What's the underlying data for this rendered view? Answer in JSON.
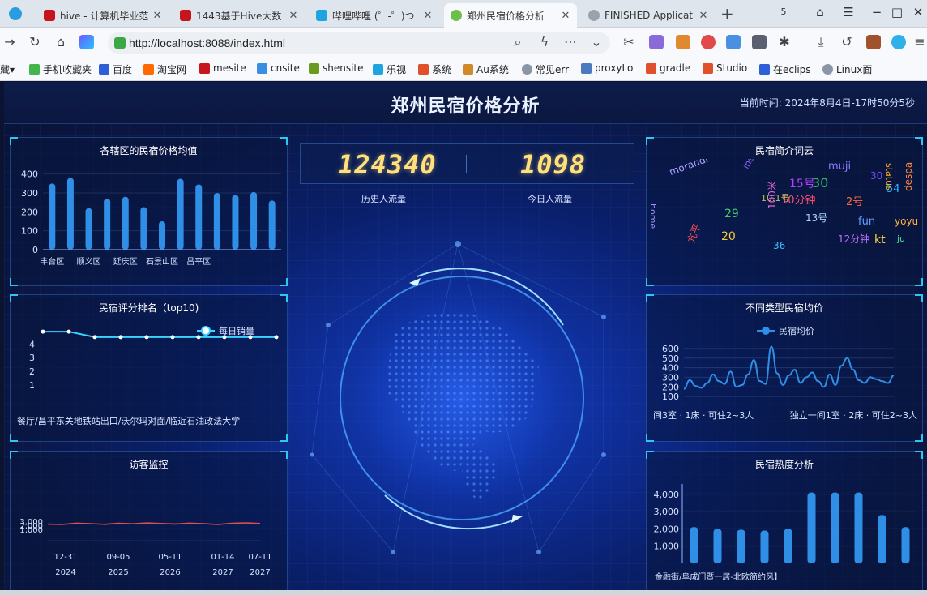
{
  "browser": {
    "tabs": [
      {
        "title": "hive - 计算机毕业范",
        "active": false
      },
      {
        "title": "1443基于Hive大数",
        "active": false
      },
      {
        "title": "哔哩哔哩 (゜-゜)つ",
        "active": false
      },
      {
        "title": "郑州民宿价格分析",
        "active": true
      },
      {
        "title": "FINISHED Applicat",
        "active": false
      }
    ],
    "url": "http://localhost:8088/index.html",
    "bookmarks": [
      "藏",
      "手机收藏夹",
      "百度",
      "淘宝网",
      "mesite",
      "cnsite",
      "shensite",
      "乐视",
      "系统",
      "Au系统",
      "常见err",
      "proxyLo",
      "gradle",
      "Studio",
      "在eclips",
      "Linux面"
    ]
  },
  "dashboard": {
    "title": "郑州民宿价格分析",
    "time_label": "当前时间:",
    "time_value": "2024年8月4日-17时50分5秒",
    "counters": [
      {
        "value": "124340",
        "label": "历史人流量"
      },
      {
        "value": "1098",
        "label": "今日人流量"
      }
    ],
    "panels": {
      "district": "各辖区的民宿价格均值",
      "rating": "民宿评分排名（top10)",
      "visitor": "访客监控",
      "wordcloud": "民宿简介词云",
      "typeavg": "不同类型民宿均价",
      "heat": "民宿热度分析"
    }
  },
  "chart_data": [
    {
      "id": "district",
      "type": "bar",
      "title": "各辖区的民宿价格均值",
      "categories": [
        "丰台区",
        "",
        "顺义区",
        "",
        "延庆区",
        "",
        "石景山区",
        "",
        "昌平区",
        "",
        "",
        "",
        ""
      ],
      "values": [
        350,
        380,
        220,
        270,
        280,
        225,
        150,
        375,
        345,
        300,
        290,
        305,
        260
      ],
      "yticks": [
        0,
        100,
        200,
        300,
        400
      ],
      "ylim": [
        0,
        420
      ]
    },
    {
      "id": "rating",
      "type": "line",
      "title": "民宿评分排名（top10)",
      "legend": "每日销量",
      "values": [
        4.9,
        4.9,
        4.5,
        4.5,
        4.5,
        4.5,
        4.5,
        4.5,
        4.5,
        4.5
      ],
      "yticks": [
        1,
        2,
        3,
        4
      ],
      "ylim": [
        0,
        5.2
      ],
      "xlabel_text": "餐厅/昌平东关地铁站出口/沃尔玛对面/临近石油政法大学"
    },
    {
      "id": "visitor",
      "type": "line",
      "title": "访客监控",
      "values": [
        2920,
        2900,
        2980,
        2950,
        2910,
        2970,
        2940,
        2990,
        2960,
        2930,
        2980,
        2950,
        2900,
        2970,
        3000,
        2960
      ],
      "ytick_labels": [
        "3,000",
        "2,000",
        "1,000"
      ],
      "xtick_labels": [
        "12-31",
        "09-05",
        "05-11",
        "01-14",
        "07-11"
      ],
      "xtick_years": [
        "2024",
        "2025",
        "2026",
        "2027",
        "2027"
      ]
    },
    {
      "id": "typeavg",
      "type": "line",
      "title": "不同类型民宿均价",
      "legend": "民宿均价",
      "values": [
        180,
        270,
        210,
        190,
        240,
        330,
        260,
        230,
        360,
        200,
        220,
        330,
        480,
        260,
        230,
        620,
        340,
        220,
        320,
        380,
        240,
        300,
        350,
        260,
        200,
        330,
        220,
        420,
        500,
        380,
        270,
        240,
        300,
        280,
        260,
        240,
        320
      ],
      "yticks": [
        100,
        200,
        300,
        400,
        500,
        600
      ],
      "ylim": [
        50,
        650
      ],
      "xtick_labels": [
        "间3室 · 1床 · 可住2~3人",
        "独立一间1室 · 2床 · 可住2~3人"
      ]
    },
    {
      "id": "heat",
      "type": "bar",
      "title": "民宿热度分析",
      "values": [
        2100,
        2000,
        1950,
        1900,
        2000,
        4100,
        4100,
        4100,
        2800,
        2100
      ],
      "ytick_labels": [
        "4,000",
        "3,000",
        "2,000",
        "1,000"
      ],
      "yticks": [
        1000,
        2000,
        3000,
        4000
      ],
      "ylim": [
        0,
        4600
      ],
      "xlabel_text": "金融街/阜成门暨一居-北欧简约风】"
    }
  ],
  "wordcloud": {
    "words": [
      {
        "t": "muji",
        "c": "#8d7cff"
      },
      {
        "t": "15号",
        "c": "#b040ff"
      },
      {
        "t": "30",
        "c": "#30c060"
      },
      {
        "t": "10分钟",
        "c": "#ff4d6d"
      },
      {
        "t": "2号",
        "c": "#ff6a3d"
      },
      {
        "t": "30",
        "c": "#7a4dff"
      },
      {
        "t": "54",
        "c": "#20b8ff"
      },
      {
        "t": "status",
        "c": "#ffb020"
      },
      {
        "t": "morandi",
        "c": "#b0a0ff"
      },
      {
        "t": "ins2",
        "c": "#9060ff"
      },
      {
        "t": "10.1号",
        "c": "#c0c060"
      },
      {
        "t": "29",
        "c": "#40d060"
      },
      {
        "t": "home",
        "c": "#a090ff"
      },
      {
        "t": "20",
        "c": "#ffcc30"
      },
      {
        "t": "100米",
        "c": "#e06ad0"
      },
      {
        "t": "13号",
        "c": "#b0d0ff"
      },
      {
        "t": "12分钟",
        "c": "#c070ff"
      },
      {
        "t": "fun",
        "c": "#60a0ff"
      },
      {
        "t": "kt",
        "c": "#ffd040"
      },
      {
        "t": "ju",
        "c": "#40e0a0"
      },
      {
        "t": "yoyu",
        "c": "#ffb040"
      },
      {
        "t": "despa",
        "c": "#ff8a40"
      },
      {
        "t": "亢平",
        "c": "#ff5050"
      },
      {
        "t": "36",
        "c": "#40c0ff"
      }
    ]
  }
}
